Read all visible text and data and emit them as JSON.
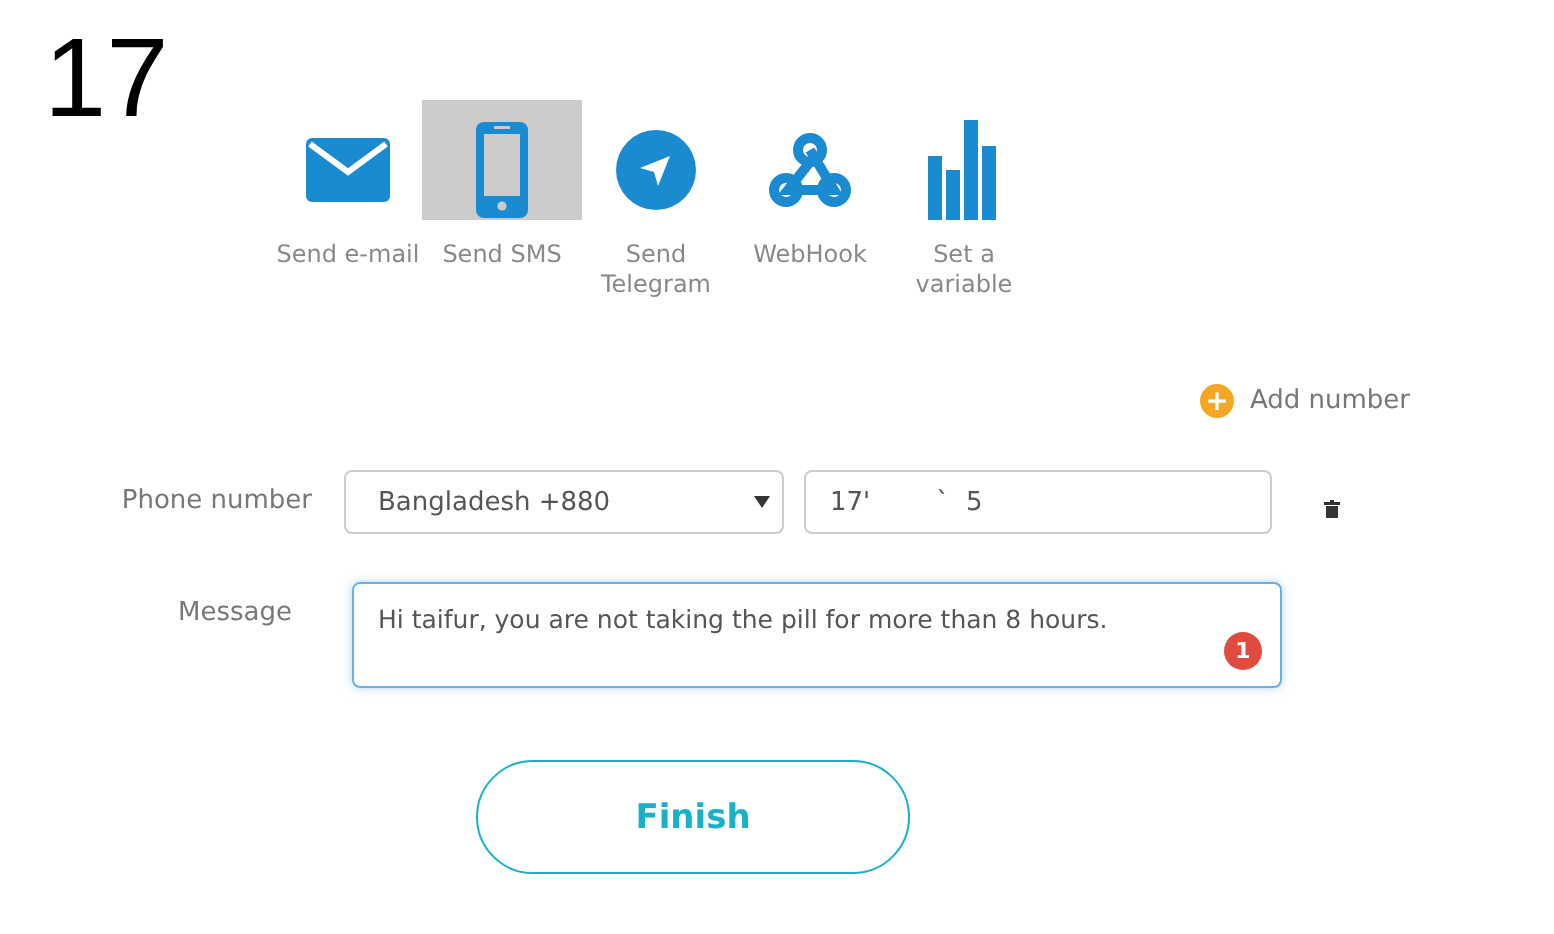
{
  "step_number": "17",
  "actions": [
    {
      "kind": "email",
      "label": "Send e-mail",
      "selected": false
    },
    {
      "kind": "sms",
      "label": "Send SMS",
      "selected": true
    },
    {
      "kind": "telegram",
      "label": "Send Telegram",
      "selected": false
    },
    {
      "kind": "webhook",
      "label": "WebHook",
      "selected": false
    },
    {
      "kind": "variable",
      "label": "Set a variable",
      "selected": false
    }
  ],
  "add_number": {
    "icon": "+",
    "label": "Add number"
  },
  "phone": {
    "label": "Phone number",
    "country": "Bangladesh +880",
    "value": "17'        `  5"
  },
  "message": {
    "label": "Message",
    "value": "Hi taifur, you are not taking the pill for more than 8 hours.",
    "badge": "1"
  },
  "finish_button": "Finish"
}
